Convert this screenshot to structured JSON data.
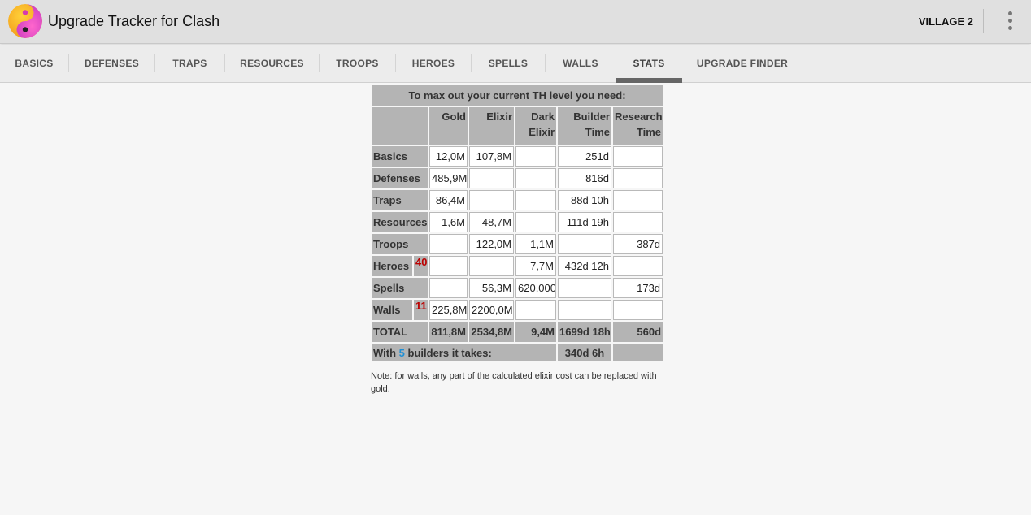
{
  "app": {
    "title": "Upgrade Tracker for Clash",
    "village": "VILLAGE 2"
  },
  "tabs": [
    {
      "label": "BASICS"
    },
    {
      "label": "DEFENSES"
    },
    {
      "label": "TRAPS"
    },
    {
      "label": "RESOURCES"
    },
    {
      "label": "TROOPS"
    },
    {
      "label": "HEROES"
    },
    {
      "label": "SPELLS"
    },
    {
      "label": "WALLS"
    },
    {
      "label": "STATS",
      "active": true
    },
    {
      "label": "UPGRADE FINDER"
    }
  ],
  "stats": {
    "title": "To max out your current TH level you need:",
    "headers": {
      "gold": "Gold",
      "elixir": "Elixir",
      "dark1": "Dark",
      "dark2": "Elixir",
      "builder1": "Builder",
      "builder2": "Time",
      "research1": "Research",
      "research2": "Time"
    },
    "rows": [
      {
        "label": "Basics",
        "badge": "",
        "gold": "12,0M",
        "elixir": "107,8M",
        "dark": "",
        "builder": "251d",
        "research": ""
      },
      {
        "label": "Defenses",
        "badge": "",
        "gold": "485,9M",
        "elixir": "",
        "dark": "",
        "builder": "816d",
        "research": ""
      },
      {
        "label": "Traps",
        "badge": "",
        "gold": "86,4M",
        "elixir": "",
        "dark": "",
        "builder": "88d 10h",
        "research": ""
      },
      {
        "label": "Resources",
        "badge": "",
        "gold": "1,6M",
        "elixir": "48,7M",
        "dark": "",
        "builder": "111d 19h",
        "research": ""
      },
      {
        "label": "Troops",
        "badge": "",
        "gold": "",
        "elixir": "122,0M",
        "dark": "1,1M",
        "builder": "",
        "research": "387d"
      },
      {
        "label": "Heroes",
        "badge": "40",
        "gold": "",
        "elixir": "",
        "dark": "7,7M",
        "builder": "432d 12h",
        "research": ""
      },
      {
        "label": "Spells",
        "badge": "",
        "gold": "",
        "elixir": "56,3M",
        "dark": "620,000",
        "builder": "",
        "research": "173d"
      },
      {
        "label": "Walls",
        "badge": "11",
        "gold": "225,8M",
        "elixir": "2200,0M",
        "dark": "",
        "builder": "",
        "research": ""
      }
    ],
    "total": {
      "label": "TOTAL",
      "gold": "811,8M",
      "elixir": "2534,8M",
      "dark": "9,4M",
      "builder": "1699d 18h",
      "research": "560d"
    },
    "builders": {
      "prefix": "With",
      "count": "5",
      "suffix": "builders it takes:",
      "time": "340d 6h"
    },
    "note": "Note: for walls, any part of the calculated elixir cost can be replaced with gold."
  }
}
